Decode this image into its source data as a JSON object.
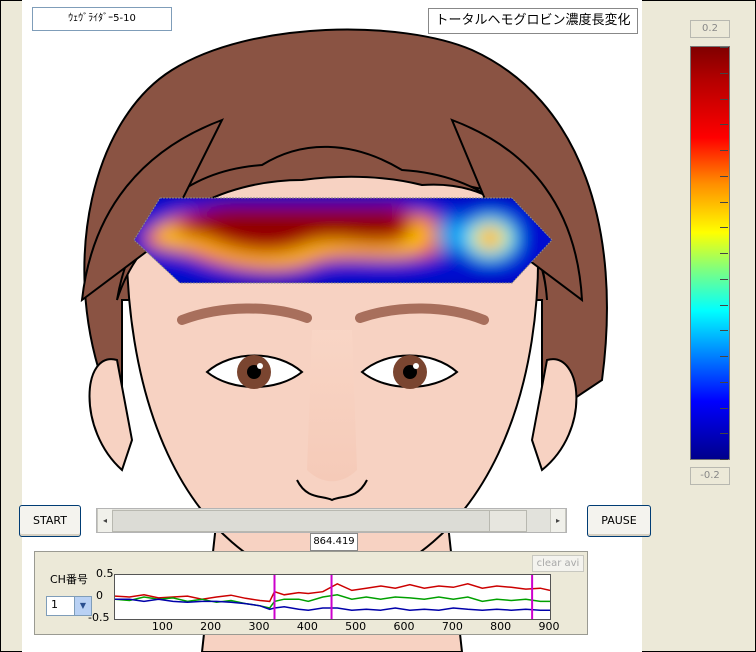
{
  "file_label": "ｳｪｳﾞﾗｲﾀﾞｰ5-10",
  "map_title": "トータルヘモグロビン濃度長変化",
  "colorbar": {
    "max_label": "0.2",
    "min_label": "-0.2",
    "colors": [
      "#800000",
      "#ff0000",
      "#ff8c00",
      "#ffff00",
      "#00ffff",
      "#0000ff",
      "#00008b"
    ]
  },
  "controls": {
    "start_label": "START",
    "pause_label": "PAUSE"
  },
  "time": {
    "value": "864.419",
    "position_fraction": 0.935
  },
  "slider": {
    "left_arrow": "◂",
    "right_arrow": "▸"
  },
  "channel": {
    "label": "CH番号",
    "selected": "1",
    "arrow": "▼"
  },
  "clear_avi_label": "clear avi",
  "chart_data": {
    "type": "line",
    "ylim": [
      -0.5,
      0.5
    ],
    "yticks": [
      "0.5",
      "0",
      "-0.5"
    ],
    "xlim": [
      0,
      900
    ],
    "xticks": [
      "100",
      "200",
      "300",
      "400",
      "500",
      "600",
      "700",
      "800",
      "900"
    ],
    "markers_x": [
      330,
      448,
      863
    ],
    "marker_color": "#cc00cc",
    "series": [
      {
        "color": "#cc0000",
        "x": [
          0,
          30,
          60,
          90,
          120,
          150,
          180,
          210,
          240,
          270,
          300,
          320,
          330,
          350,
          380,
          400,
          430,
          460,
          490,
          520,
          550,
          580,
          610,
          640,
          670,
          700,
          730,
          760,
          790,
          820,
          850,
          880,
          900
        ],
        "y": [
          0.02,
          0.0,
          0.05,
          -0.02,
          0.0,
          0.02,
          -0.05,
          0.0,
          0.04,
          -0.03,
          -0.08,
          -0.1,
          0.12,
          0.05,
          0.1,
          0.08,
          0.12,
          0.3,
          0.15,
          0.2,
          0.25,
          0.2,
          0.28,
          0.2,
          0.25,
          0.22,
          0.3,
          0.2,
          0.25,
          0.22,
          0.18,
          0.2,
          0.15
        ]
      },
      {
        "color": "#00a000",
        "x": [
          0,
          30,
          60,
          90,
          120,
          150,
          180,
          210,
          240,
          270,
          300,
          320,
          330,
          350,
          380,
          400,
          430,
          460,
          490,
          520,
          550,
          580,
          610,
          640,
          670,
          700,
          730,
          760,
          790,
          820,
          850,
          880,
          900
        ],
        "y": [
          -0.05,
          -0.08,
          0.0,
          -0.05,
          -0.02,
          -0.1,
          -0.05,
          -0.12,
          -0.08,
          -0.15,
          -0.2,
          -0.25,
          -0.1,
          -0.05,
          -0.05,
          -0.1,
          0.0,
          0.05,
          -0.05,
          0.0,
          -0.05,
          0.0,
          -0.02,
          -0.05,
          0.0,
          -0.05,
          0.0,
          -0.1,
          -0.05,
          -0.08,
          -0.05,
          -0.1,
          -0.1
        ]
      },
      {
        "color": "#0000aa",
        "x": [
          0,
          30,
          60,
          90,
          120,
          150,
          180,
          210,
          240,
          270,
          300,
          320,
          330,
          350,
          380,
          400,
          430,
          460,
          490,
          520,
          550,
          580,
          610,
          640,
          670,
          700,
          730,
          760,
          790,
          820,
          850,
          880,
          900
        ],
        "y": [
          -0.05,
          -0.05,
          -0.1,
          -0.05,
          -0.1,
          -0.12,
          -0.1,
          -0.1,
          -0.12,
          -0.15,
          -0.2,
          -0.28,
          -0.25,
          -0.22,
          -0.28,
          -0.3,
          -0.25,
          -0.25,
          -0.3,
          -0.28,
          -0.3,
          -0.25,
          -0.3,
          -0.28,
          -0.3,
          -0.25,
          -0.28,
          -0.3,
          -0.28,
          -0.3,
          -0.28,
          -0.3,
          -0.3
        ]
      }
    ]
  }
}
